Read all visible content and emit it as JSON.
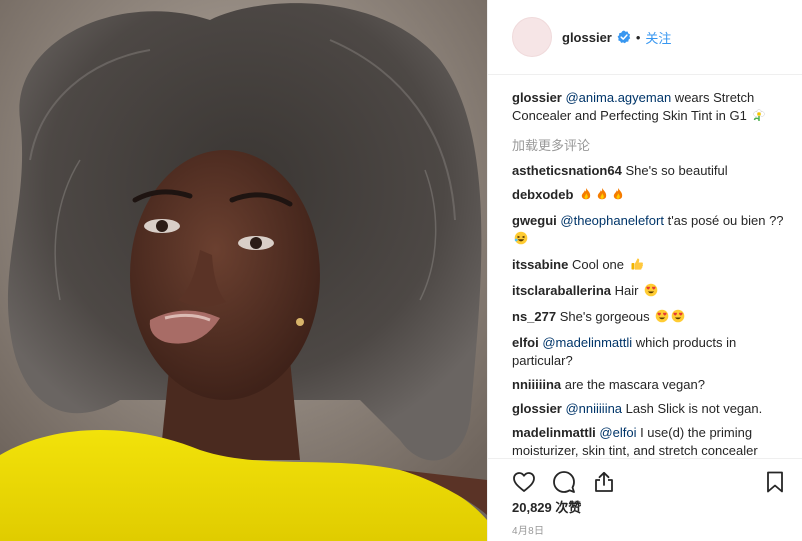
{
  "post": {
    "image_alt": "Selfie of a woman with voluminous natural hair wearing a yellow top"
  },
  "header": {
    "username": "glossier",
    "separator": "•",
    "follow_label": "关注"
  },
  "caption": {
    "user": "glossier",
    "mention": "@anima.agyeman",
    "text": " wears Stretch Concealer and Perfecting Skin Tint in G1"
  },
  "load_more_label": "加载更多评论",
  "comments": [
    {
      "user": "astheticsnation64",
      "mention": "",
      "text": " She's so beautiful"
    },
    {
      "user": "debxodeb",
      "mention": "",
      "text": ""
    },
    {
      "user": "gwegui",
      "mention": "@theophanelefort",
      "text": " t'as posé ou bien ??"
    },
    {
      "user": "itssabine",
      "mention": "",
      "text": " Cool one"
    },
    {
      "user": "itsclaraballerina",
      "mention": "",
      "text": " Hair"
    },
    {
      "user": "ns_277",
      "mention": "",
      "text": " She's gorgeous"
    },
    {
      "user": "elfoi",
      "mention": "@madelinmattli",
      "text": " which products in particular?"
    },
    {
      "user": "nniiiiina",
      "mention": "",
      "text": " are the mascara vegan?"
    },
    {
      "user": "glossier",
      "mention": "@nniiiiina",
      "text": " Lash Slick is not vegan."
    },
    {
      "user": "madelinmattli",
      "mention": "@elfoi",
      "text": " I use(d) the priming moisturizer, skin tint, and stretch concealer"
    }
  ],
  "likes": "20,829 次赞",
  "date": "4月8日",
  "icons": {
    "like": "heart-icon",
    "comment": "comment-bubble-icon",
    "share": "share-icon",
    "save": "bookmark-icon",
    "verified": "verified-badge-icon"
  },
  "colors": {
    "link_blue": "#3897f0",
    "mention_blue": "#003569",
    "muted": "#999999",
    "text": "#262626",
    "verified": "#3897f0"
  }
}
